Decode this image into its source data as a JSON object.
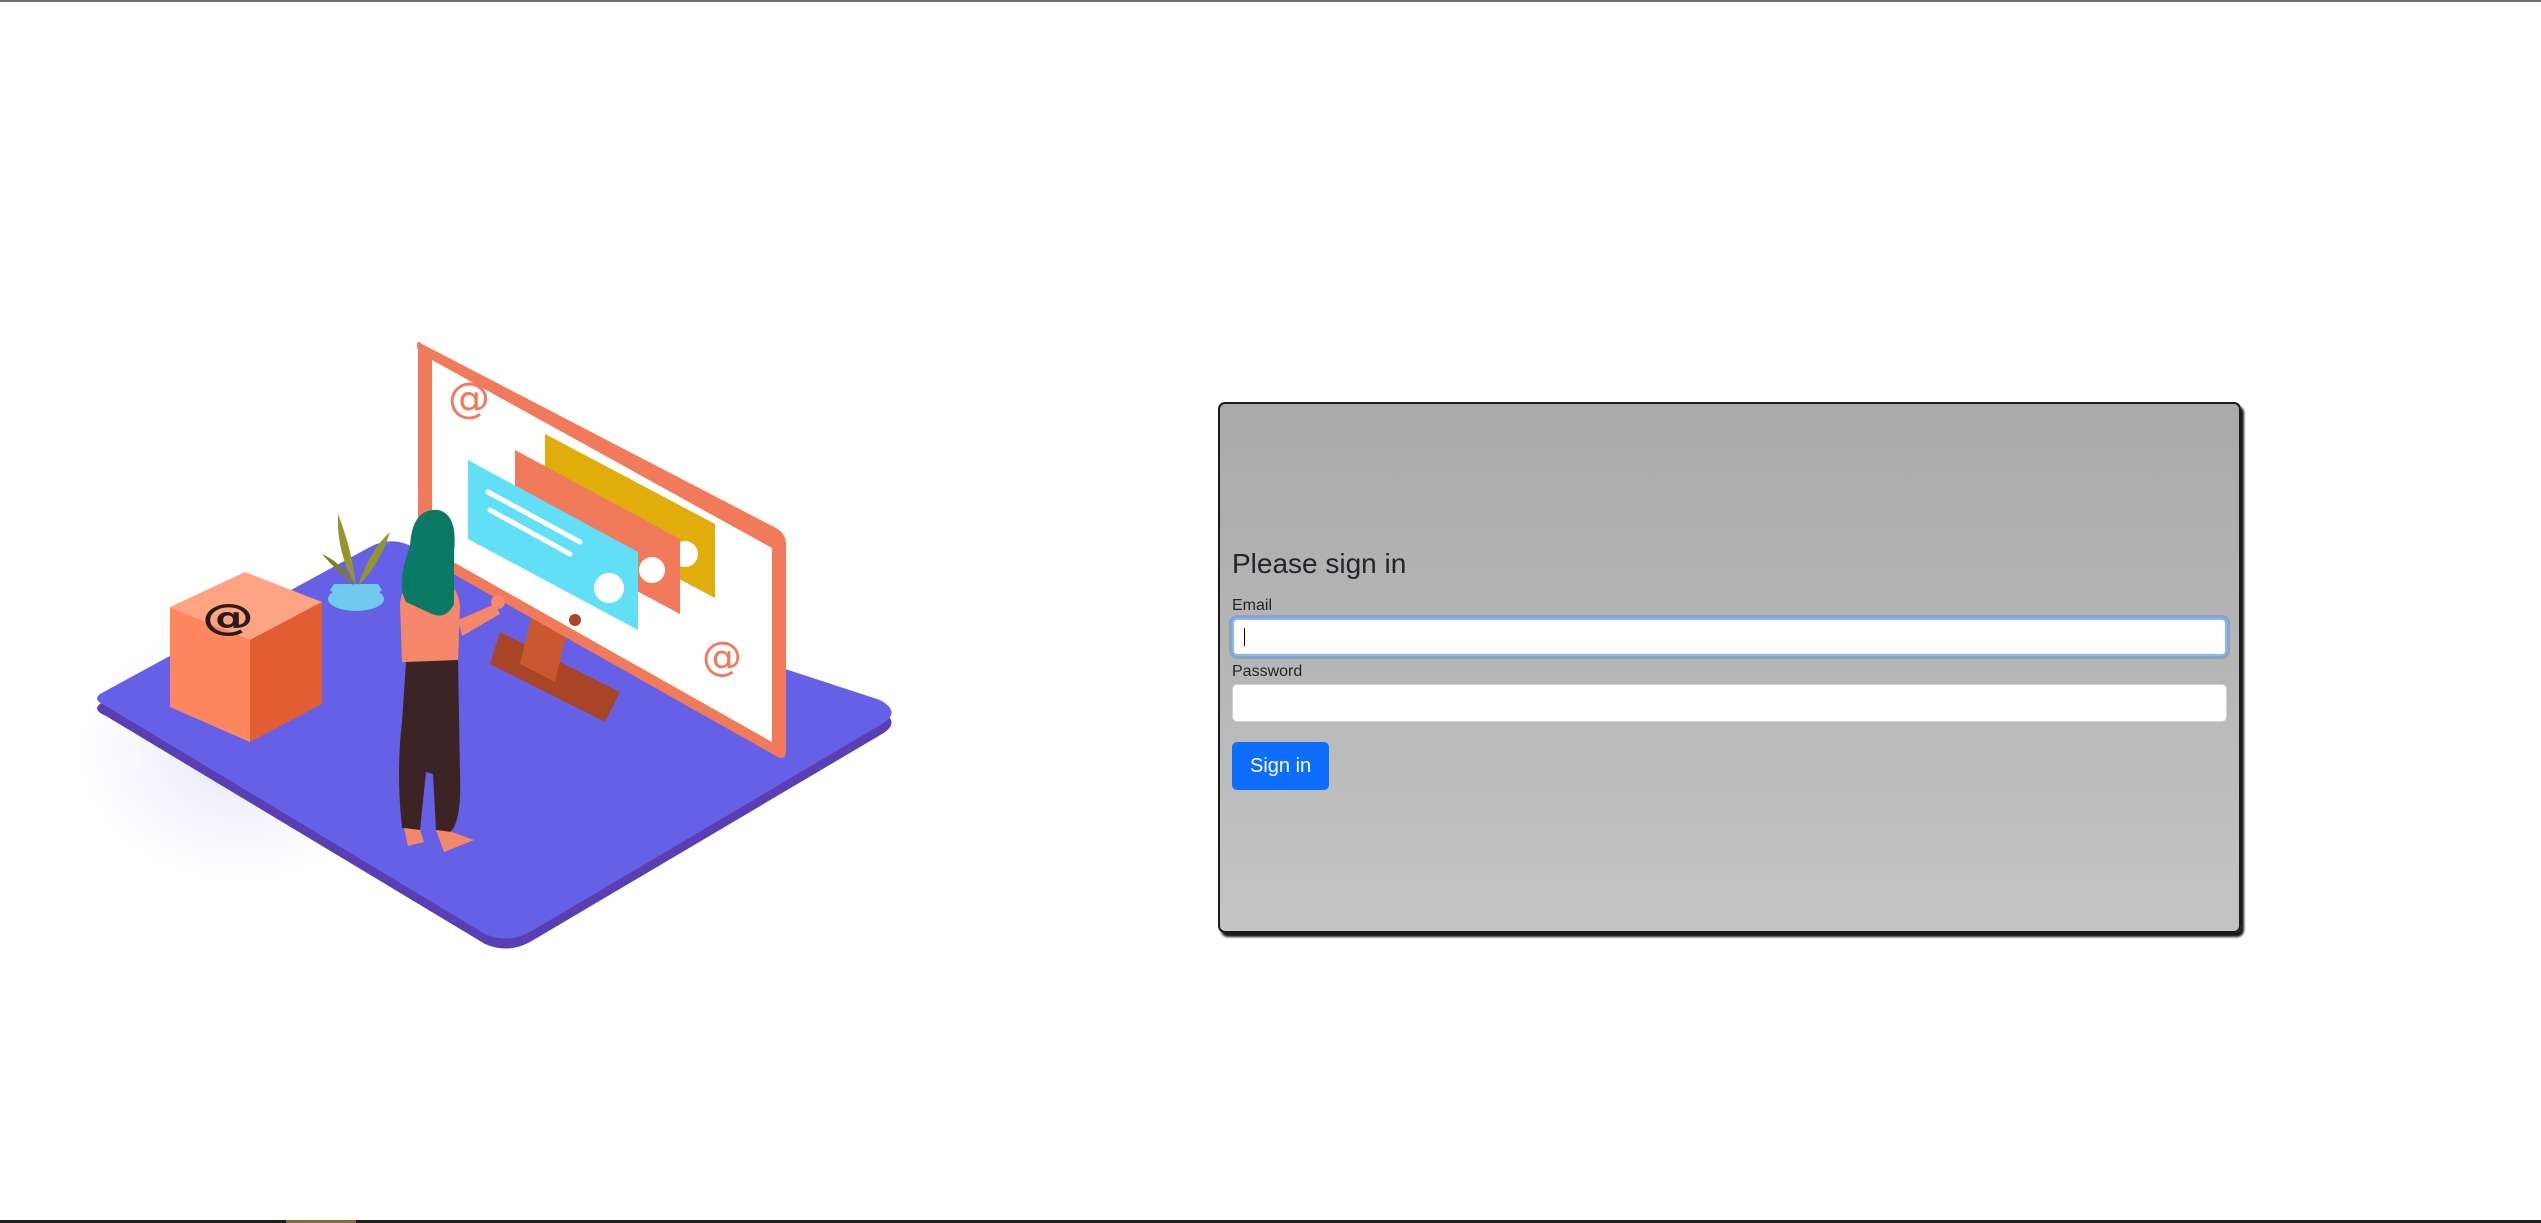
{
  "login": {
    "title": "Please sign in",
    "email_label": "Email",
    "email_value": "",
    "password_label": "Password",
    "password_value": "",
    "submit_label": "Sign in"
  },
  "illustration": {
    "icon": "email-marketing-illustration",
    "colors": {
      "platform": "#6660e6",
      "platform_edge": "#5540b8",
      "monitor": "#f07a5a",
      "box": "#f8875f",
      "card_blue": "#60dff7",
      "card_yellow": "#e1ad0a",
      "hair": "#0b7a65",
      "pants": "#3d2424",
      "plant": "#93962b"
    }
  },
  "colors": {
    "primary_button": "#0d6efd",
    "card_background": "#b5b5b5",
    "focus_ring": "#86b7fe"
  }
}
